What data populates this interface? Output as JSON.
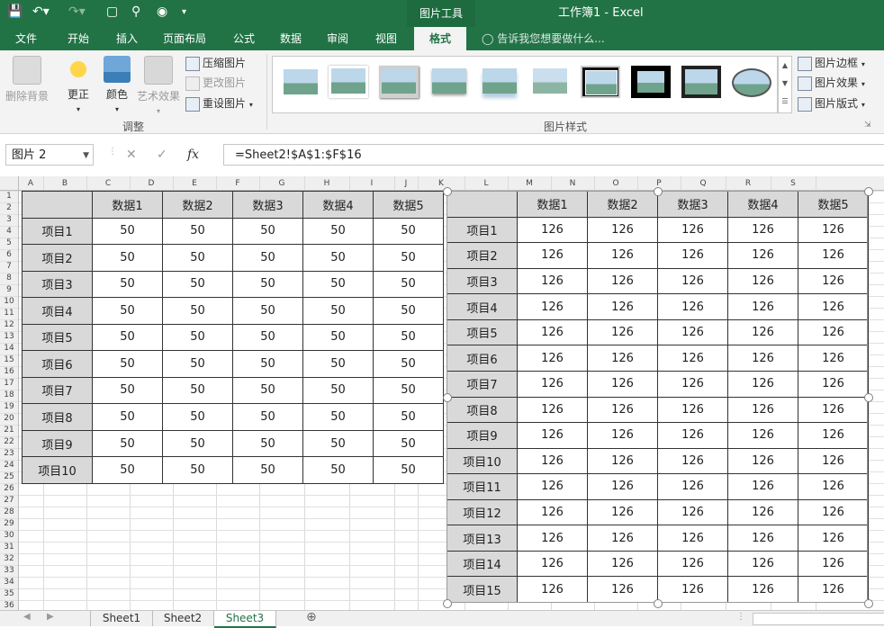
{
  "window": {
    "title": "工作簿1 - Excel",
    "context_tab": "图片工具"
  },
  "tabs": [
    "文件",
    "开始",
    "插入",
    "页面布局",
    "公式",
    "数据",
    "审阅",
    "视图",
    "格式"
  ],
  "active_tab": "格式",
  "tell_me": "告诉我您想要做什么...",
  "ribbon": {
    "adjust": {
      "remove_bg": "删除背景",
      "corrections": "更正",
      "color": "颜色",
      "art_effects": "艺术效果",
      "compress": "压缩图片",
      "change": "更改图片",
      "reset": "重设图片",
      "group_label": "调整"
    },
    "styles": {
      "group_label": "图片样式",
      "border": "图片边框",
      "effects": "图片效果",
      "layout": "图片版式"
    }
  },
  "formula_bar": {
    "name_box": "图片 2",
    "fx": "fx",
    "formula": "=Sheet2!$A$1:$F$16"
  },
  "columns": [
    "A",
    "B",
    "C",
    "D",
    "E",
    "F",
    "G",
    "H",
    "I",
    "J",
    "K",
    "L",
    "M",
    "N",
    "O",
    "P",
    "Q",
    "R",
    "S"
  ],
  "rows": [
    "1",
    "2",
    "3",
    "4",
    "5",
    "6",
    "7",
    "8",
    "9",
    "10",
    "11",
    "12",
    "13",
    "14",
    "15",
    "16",
    "17",
    "18",
    "19",
    "20",
    "21",
    "22",
    "23",
    "24",
    "25",
    "26",
    "27",
    "28",
    "29",
    "30",
    "31",
    "32",
    "33",
    "34",
    "35",
    "36"
  ],
  "table1": {
    "headers": [
      "",
      "数据1",
      "数据2",
      "数据3",
      "数据4",
      "数据5"
    ],
    "rows": [
      [
        "项目1",
        "50",
        "50",
        "50",
        "50",
        "50"
      ],
      [
        "项目2",
        "50",
        "50",
        "50",
        "50",
        "50"
      ],
      [
        "项目3",
        "50",
        "50",
        "50",
        "50",
        "50"
      ],
      [
        "项目4",
        "50",
        "50",
        "50",
        "50",
        "50"
      ],
      [
        "项目5",
        "50",
        "50",
        "50",
        "50",
        "50"
      ],
      [
        "项目6",
        "50",
        "50",
        "50",
        "50",
        "50"
      ],
      [
        "项目7",
        "50",
        "50",
        "50",
        "50",
        "50"
      ],
      [
        "项目8",
        "50",
        "50",
        "50",
        "50",
        "50"
      ],
      [
        "项目9",
        "50",
        "50",
        "50",
        "50",
        "50"
      ],
      [
        "项目10",
        "50",
        "50",
        "50",
        "50",
        "50"
      ]
    ]
  },
  "table2": {
    "headers": [
      "",
      "数据1",
      "数据2",
      "数据3",
      "数据4",
      "数据5"
    ],
    "rows": [
      [
        "项目1",
        "126",
        "126",
        "126",
        "126",
        "126"
      ],
      [
        "项目2",
        "126",
        "126",
        "126",
        "126",
        "126"
      ],
      [
        "项目3",
        "126",
        "126",
        "126",
        "126",
        "126"
      ],
      [
        "项目4",
        "126",
        "126",
        "126",
        "126",
        "126"
      ],
      [
        "项目5",
        "126",
        "126",
        "126",
        "126",
        "126"
      ],
      [
        "项目6",
        "126",
        "126",
        "126",
        "126",
        "126"
      ],
      [
        "项目7",
        "126",
        "126",
        "126",
        "126",
        "126"
      ],
      [
        "项目8",
        "126",
        "126",
        "126",
        "126",
        "126"
      ],
      [
        "项目9",
        "126",
        "126",
        "126",
        "126",
        "126"
      ],
      [
        "项目10",
        "126",
        "126",
        "126",
        "126",
        "126"
      ],
      [
        "项目11",
        "126",
        "126",
        "126",
        "126",
        "126"
      ],
      [
        "项目12",
        "126",
        "126",
        "126",
        "126",
        "126"
      ],
      [
        "项目13",
        "126",
        "126",
        "126",
        "126",
        "126"
      ],
      [
        "项目14",
        "126",
        "126",
        "126",
        "126",
        "126"
      ],
      [
        "项目15",
        "126",
        "126",
        "126",
        "126",
        "126"
      ]
    ]
  },
  "sheets": [
    "Sheet1",
    "Sheet2",
    "Sheet3"
  ],
  "active_sheet": "Sheet3",
  "colors": {
    "accent": "#217346",
    "header_fill": "#d9d9d9"
  }
}
